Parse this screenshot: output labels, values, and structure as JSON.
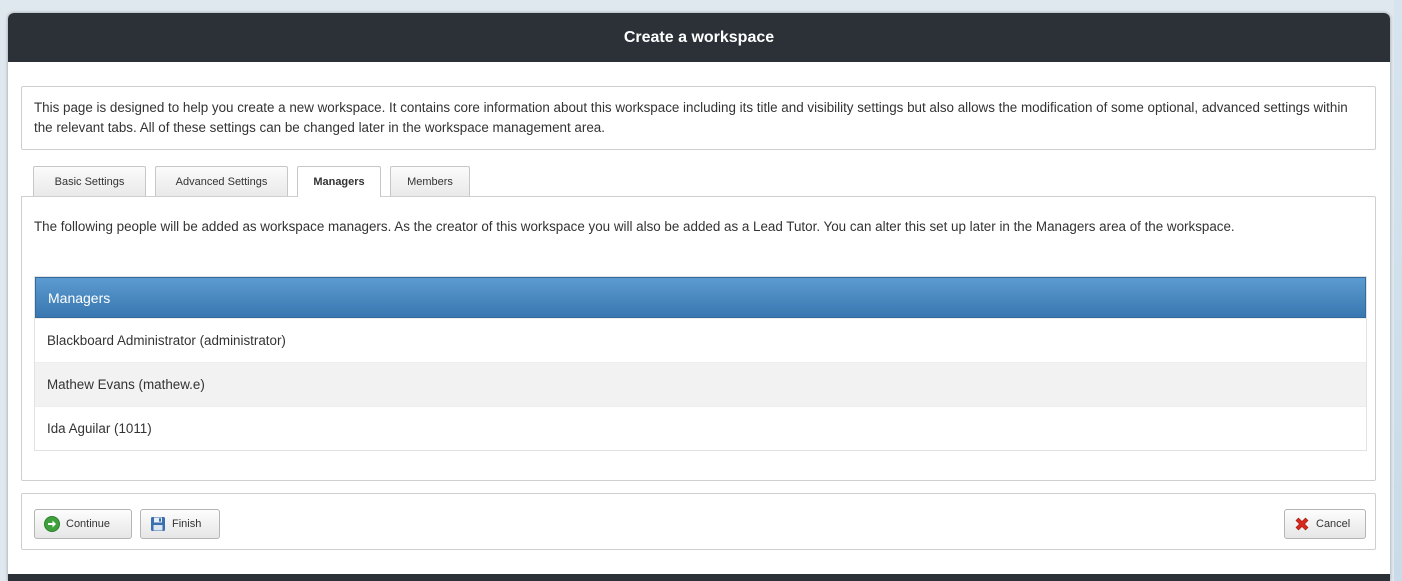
{
  "dialog": {
    "title": "Create a workspace",
    "intro": "This page is designed to help you create a new workspace. It contains core information about this workspace including its title and visibility settings but also allows the modification of some optional, advanced settings within the relevant tabs. All of these settings can be changed later in the workspace management area."
  },
  "tabs": [
    {
      "label": "Basic Settings"
    },
    {
      "label": "Advanced Settings"
    },
    {
      "label": "Managers"
    },
    {
      "label": "Members"
    }
  ],
  "managers_panel": {
    "description": "The following people will be added as workspace managers. As the creator of this workspace you will also be added as a Lead Tutor. You can alter this set up later in the Managers area of the workspace.",
    "header": "Managers",
    "rows": [
      "Blackboard Administrator (administrator)",
      "Mathew Evans (mathew.e)",
      "Ida Aguilar (1011)"
    ]
  },
  "actions": {
    "continue_label": "Continue",
    "finish_label": "Finish",
    "cancel_label": "Cancel"
  },
  "colors": {
    "header_bg": "#2b3136",
    "table_header": "#4a89c2",
    "continue_icon": "#3ea13e",
    "finish_icon": "#3a6fb0",
    "cancel_icon": "#d8271c"
  },
  "icons": {
    "continue": "arrow-right-circle-icon",
    "finish": "floppy-disk-icon",
    "cancel": "red-x-icon"
  }
}
